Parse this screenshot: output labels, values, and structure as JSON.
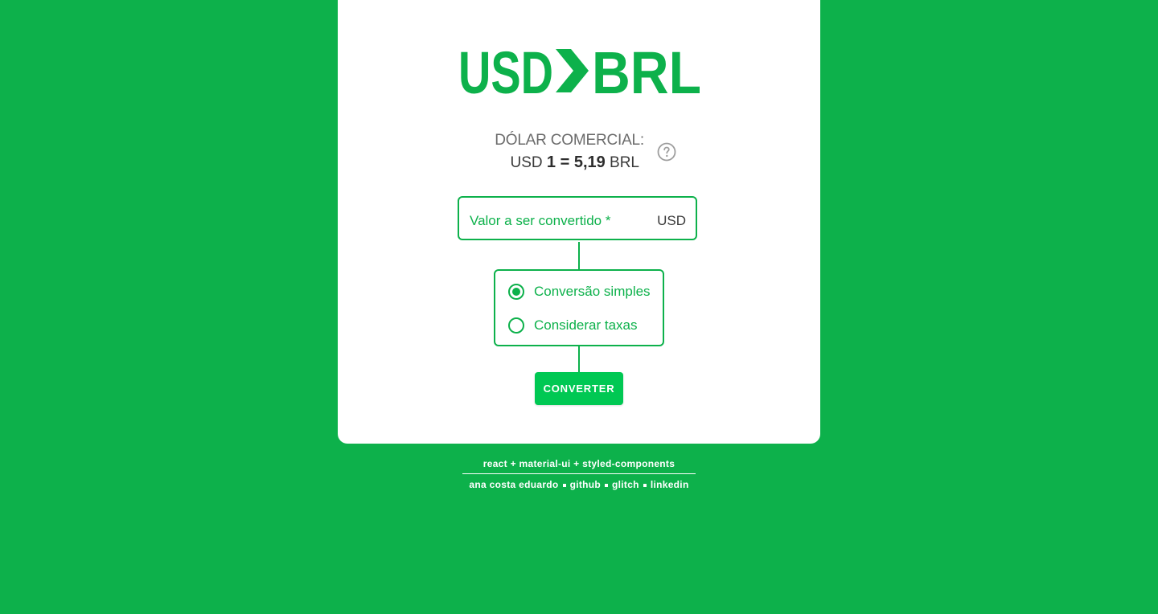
{
  "colors": {
    "background": "#0db14b",
    "card": "#ffffff",
    "accent": "#0db14b",
    "button": "#00c853",
    "text_dark": "#3a3a3a",
    "text_muted": "#6b6b6b"
  },
  "logo": {
    "left_text": "USD",
    "right_text": "BRL",
    "icon": "arrow-right-icon"
  },
  "rate": {
    "label": "DÓLAR COMERCIAL:",
    "from_currency": "USD",
    "equation": "1 = 5,19",
    "to_currency": "BRL",
    "help_icon": "help-circle-icon"
  },
  "amount_input": {
    "placeholder": "Valor a ser convertido *",
    "value": "",
    "suffix": "USD"
  },
  "conversion_type": {
    "selected": "Conversão simples",
    "options": [
      "Conversão simples",
      "Considerar taxas"
    ]
  },
  "convert_button": {
    "label": "CONVERTER"
  },
  "footer": {
    "tech": "react + material-ui + styled-components",
    "links": [
      "ana costa eduardo",
      "github",
      "glitch",
      "linkedin"
    ]
  }
}
